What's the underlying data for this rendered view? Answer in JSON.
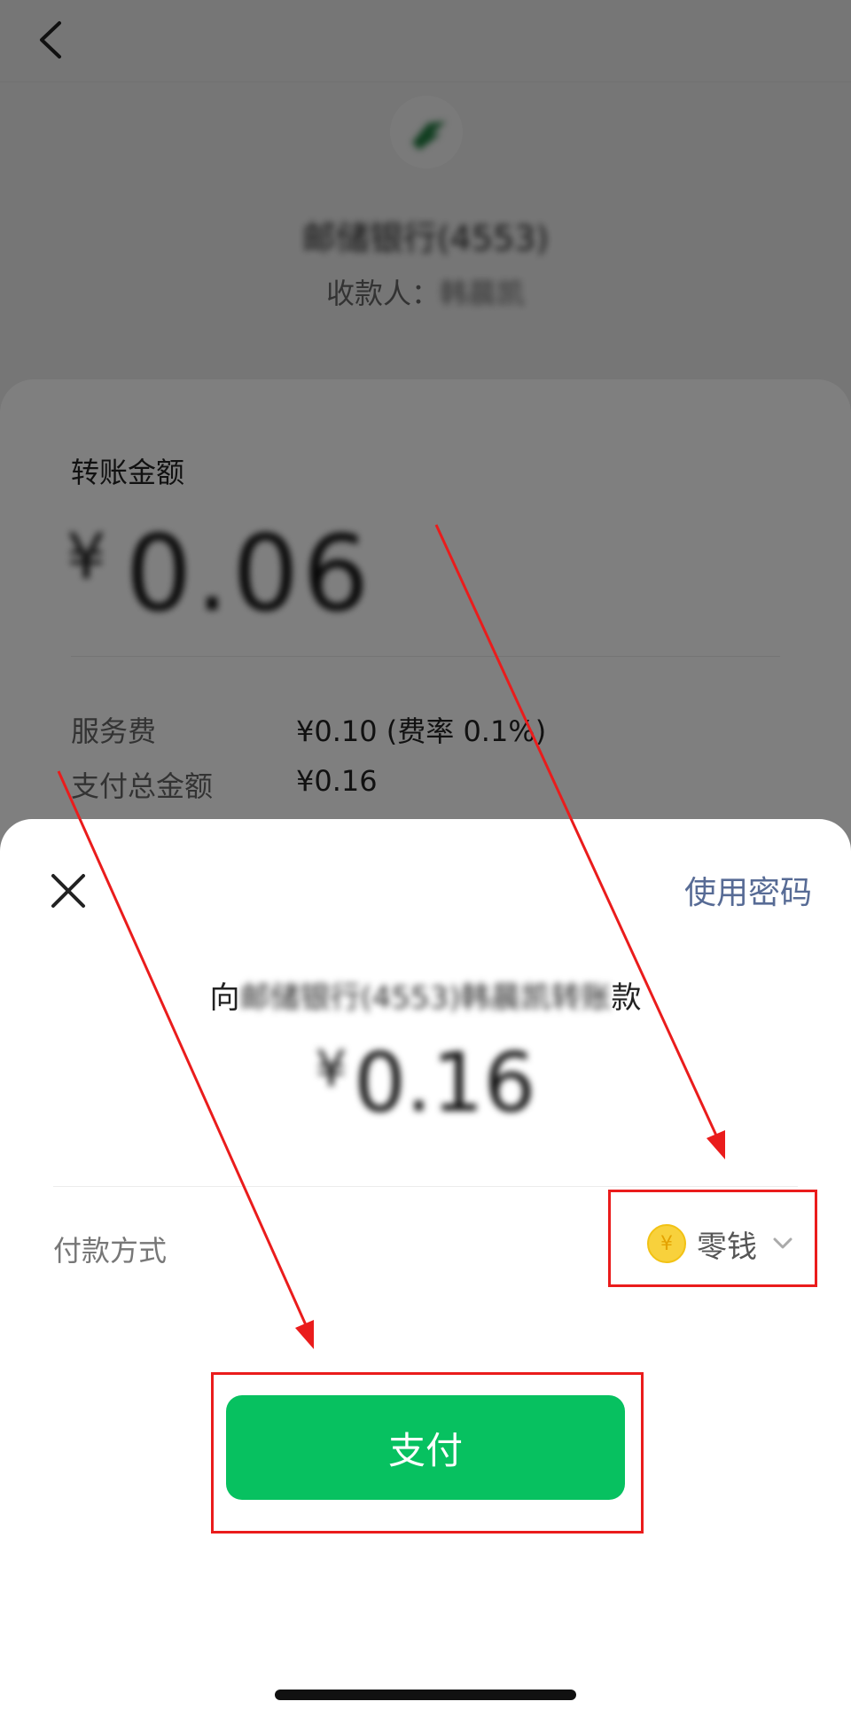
{
  "background": {
    "bank_name": "邮储银行(4553)",
    "payee_label": "收款人：",
    "payee_name": "韩晨凯",
    "card": {
      "amount_label": "转账金额",
      "amount_currency": "¥",
      "amount_value": "0.06",
      "service_fee_label": "服务费",
      "service_fee_value": "¥0.10 (费率 0.1%)",
      "total_label": "支付总金额",
      "total_value": "¥0.16"
    }
  },
  "sheet": {
    "use_password": "使用密码",
    "to_prefix": "向",
    "to_target": "邮储银行(4553)韩晨凯转账",
    "to_suffix": "款",
    "amount_currency": "¥",
    "amount_value": "0.16",
    "pay_method_label": "付款方式",
    "pay_method_value": "零钱",
    "coin_symbol": "¥",
    "pay_button": "支付"
  },
  "colors": {
    "accent_green": "#07c160",
    "link_blue": "#576b95",
    "annotation_red": "#ea1c1c"
  },
  "icons": [
    "chevron-left-icon",
    "bank-logo-icon",
    "close-icon",
    "coin-icon",
    "chevron-down-icon"
  ]
}
